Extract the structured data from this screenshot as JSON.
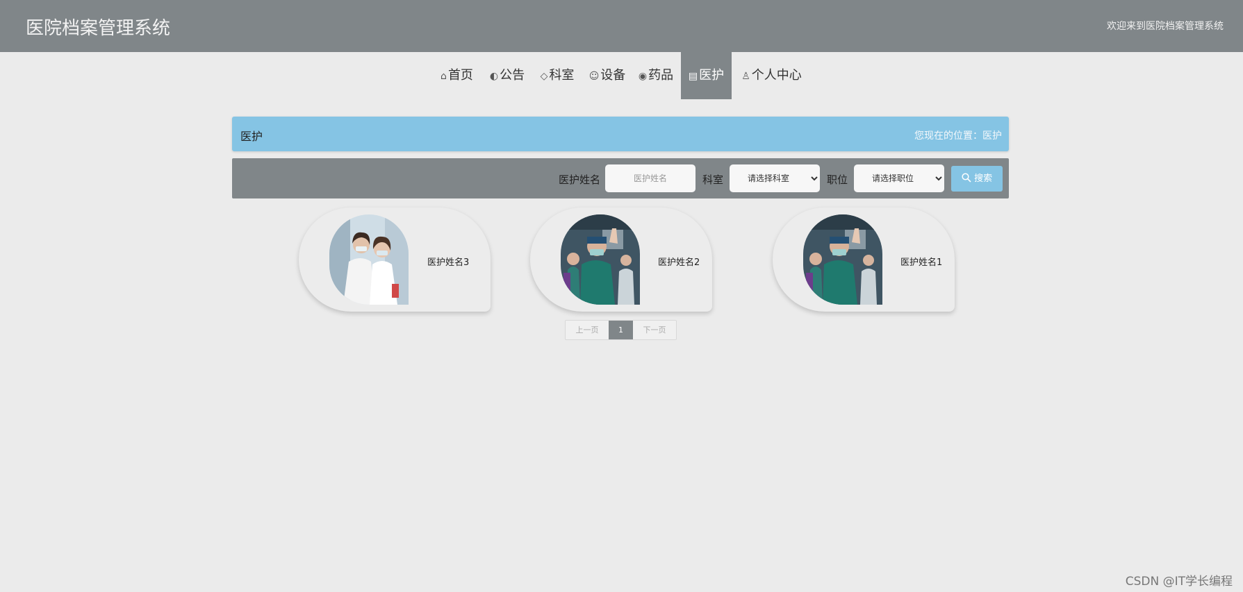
{
  "app": {
    "title": "医院档案管理系统",
    "welcome": "欢迎来到医院档案管理系统"
  },
  "nav": {
    "items": [
      {
        "label": "首页",
        "icon": "home-icon"
      },
      {
        "label": "公告",
        "icon": "palette-icon"
      },
      {
        "label": "科室",
        "icon": "tag-icon"
      },
      {
        "label": "设备",
        "icon": "smile-icon"
      },
      {
        "label": "药品",
        "icon": "globe-icon"
      },
      {
        "label": "医护",
        "icon": "clipboard-icon",
        "active": true
      },
      {
        "label": "个人中心",
        "icon": "user-icon"
      }
    ]
  },
  "banner": {
    "title": "医护",
    "location": "您现在的位置：医护"
  },
  "search": {
    "name_label": "医护姓名",
    "name_placeholder": "医护姓名",
    "dept_label": "科室",
    "dept_selected": "请选择科室",
    "position_label": "职位",
    "position_selected": "请选择职位",
    "button_label": "搜索"
  },
  "cards": [
    {
      "name": "医护姓名3"
    },
    {
      "name": "医护姓名2"
    },
    {
      "name": "医护姓名1"
    }
  ],
  "pagination": {
    "prev": "上一页",
    "current": "1",
    "next": "下一页"
  },
  "watermark": "CSDN @IT学长编程",
  "colors": {
    "header": "#808689",
    "accent": "#85c4e4",
    "background": "#ebebeb"
  }
}
